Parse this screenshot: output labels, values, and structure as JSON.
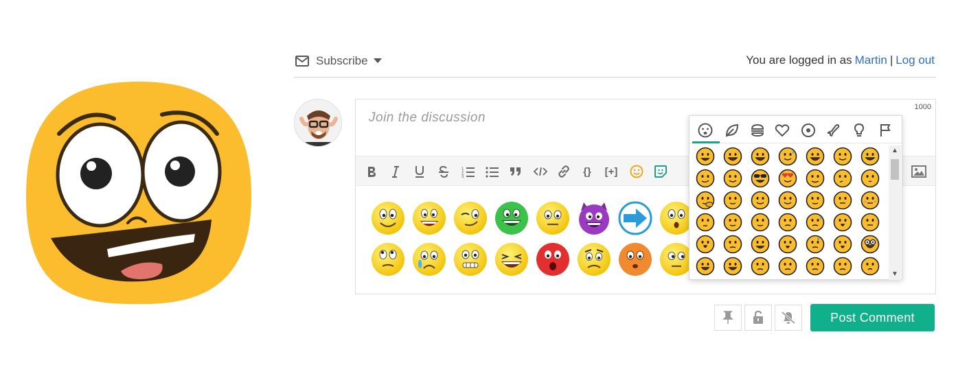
{
  "header": {
    "subscribe_label": "Subscribe",
    "logged_in_prefix": "You are logged in as",
    "user_name": "Martin",
    "separator": "|",
    "logout_label": "Log out"
  },
  "editor": {
    "placeholder": "Join the discussion",
    "char_limit": "1000",
    "toolbar": {
      "ordered_list_glyph": "1≡",
      "blockquote_glyph": "❞",
      "code_glyph": "</>",
      "braces_glyph": "{}",
      "spoiler_glyph": "[+]"
    }
  },
  "emoji_popup": {
    "categories": [
      "smileys",
      "nature",
      "food",
      "activities",
      "travel",
      "objects",
      "symbols",
      "flags"
    ],
    "active_category": "smileys"
  },
  "actions": {
    "post_label": "Post Comment"
  },
  "colors": {
    "accent": "#11b08c",
    "link": "#2f6fbf",
    "emoji_yellow": "#fbbc2d"
  }
}
